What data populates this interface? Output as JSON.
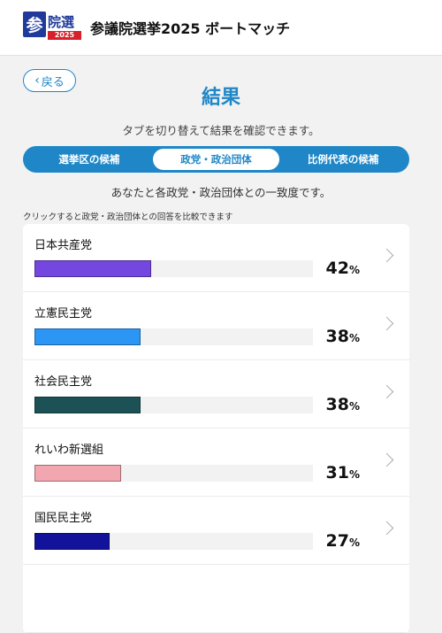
{
  "header": {
    "logo_char": "参",
    "logo_text": "院選",
    "logo_year": "2025",
    "title": "参議院選挙2025 ボートマッチ"
  },
  "nav": {
    "back_label": "戻る"
  },
  "page": {
    "title": "結果",
    "subtitle": "タブを切り替えて結果を確認できます。",
    "info": "あなたと各政党・政治団体との一致度です。",
    "hint": "クリックすると政党・政治団体との回答を比較できます"
  },
  "tabs": [
    {
      "label": "選挙区の候補",
      "active": false
    },
    {
      "label": "政党・政治団体",
      "active": true
    },
    {
      "label": "比例代表の候補",
      "active": false
    }
  ],
  "results": [
    {
      "name": "日本共産党",
      "percent": 42,
      "unit": "%",
      "color": "#7447e0"
    },
    {
      "name": "立憲民主党",
      "percent": 38,
      "unit": "%",
      "color": "#2c96f5"
    },
    {
      "name": "社会民主党",
      "percent": 38,
      "unit": "%",
      "color": "#1c5256"
    },
    {
      "name": "れいわ新選組",
      "percent": 31,
      "unit": "%",
      "color": "#f2a7b0"
    },
    {
      "name": "国民民主党",
      "percent": 27,
      "unit": "%",
      "color": "#12129a"
    }
  ]
}
